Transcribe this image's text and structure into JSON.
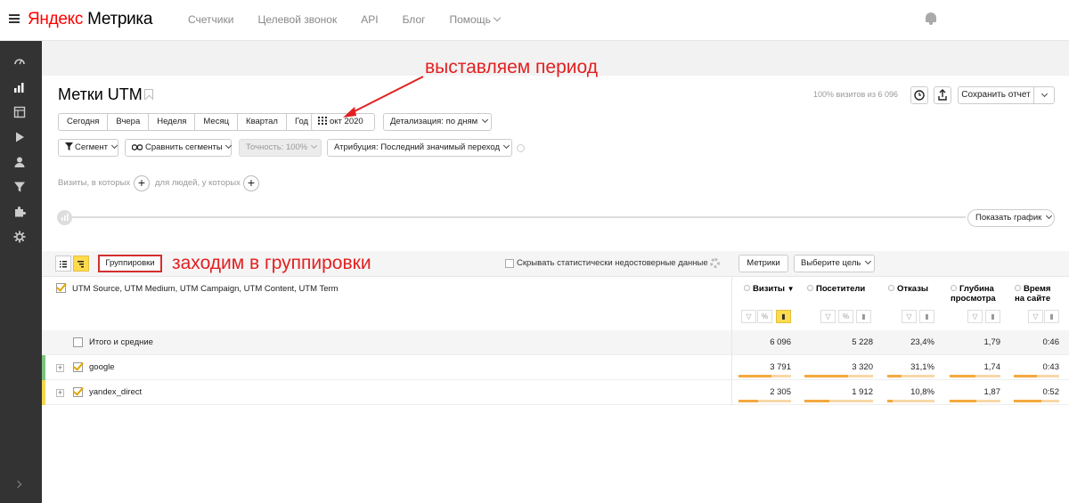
{
  "app": {
    "logo_brand": "Яндекс",
    "logo_product": "Метрика",
    "nav": [
      "Счетчики",
      "Целевой звонок",
      "API",
      "Блог",
      "Помощь"
    ]
  },
  "sidebar_icons": [
    "dashboard-icon",
    "reports-icon",
    "layout-icon",
    "play-icon",
    "user-icon",
    "filter-icon",
    "puzzle-icon",
    "gear-icon"
  ],
  "page": {
    "title": "Метки UTM",
    "visits_note": "100% визитов из 6 096",
    "save_label": "Сохранить отчет"
  },
  "periods": [
    "Сегодня",
    "Вчера",
    "Неделя",
    "Месяц",
    "Квартал",
    "Год"
  ],
  "date_picker": "окт 2020",
  "detail": "Детализация: по дням",
  "segment": "Сегмент",
  "compare": "Сравнить сегменты",
  "accuracy": "Точность: 100%",
  "attribution": "Атрибуция: Последний значимый переход",
  "filter": {
    "visits_label": "Визиты, в которых",
    "people_label": "для людей, у которых"
  },
  "show_graph": "Показать график",
  "table_toolbar": {
    "groupings": "Группировки",
    "hide_label": "Скрывать статистически недостоверные данные",
    "metrics_btn": "Метрики",
    "goal_btn": "Выберите цель"
  },
  "dimension_header": "UTM Source, UTM Medium, UTM Campaign, UTM Content, UTM Term",
  "metric_headers": [
    {
      "line1": "Визиты",
      "line2": "",
      "sorted": "▼"
    },
    {
      "line1": "Посетители",
      "line2": ""
    },
    {
      "line1": "Отказы",
      "line2": ""
    },
    {
      "line1": "Глубина",
      "line2": "просмотра"
    },
    {
      "line1": "Время",
      "line2": "на сайте"
    }
  ],
  "rows": [
    {
      "label": "Итого и средние",
      "values": [
        "6 096",
        "5 228",
        "23,4%",
        "1,79",
        "0:46"
      ]
    },
    {
      "label": "google",
      "values": [
        "3 791",
        "3 320",
        "31,1%",
        "1,74",
        "0:43"
      ],
      "bars": [
        0.62,
        0.64,
        0.31,
        0.5,
        0.5
      ]
    },
    {
      "label": "yandex_direct",
      "values": [
        "2 305",
        "1 912",
        "10,8%",
        "1,87",
        "0:52"
      ],
      "bars": [
        0.38,
        0.36,
        0.11,
        0.53,
        0.6
      ]
    }
  ],
  "annotations": {
    "period": "выставляем период",
    "groupings": "заходим в группировки"
  },
  "colors": {
    "accent": "#ffdb4d",
    "annotation": "#e32021",
    "bar": "#f4a93e",
    "sidebar": "#333333"
  }
}
